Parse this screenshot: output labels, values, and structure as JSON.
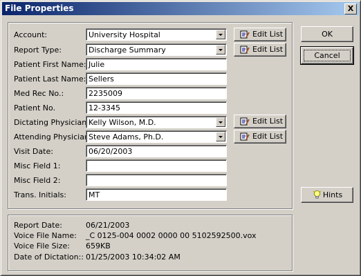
{
  "window": {
    "title": "File Properties",
    "close_glyph": "X"
  },
  "form": {
    "account": {
      "label": "Account:",
      "value": "University Hospital"
    },
    "report_type": {
      "label": "Report Type:",
      "value": "Discharge Summary"
    },
    "patient_first": {
      "label": "Patient First Name:",
      "value": "Julie"
    },
    "patient_last": {
      "label": "Patient Last Name:",
      "value": "Sellers"
    },
    "med_rec": {
      "label": "Med Rec No.:",
      "value": "2235009"
    },
    "patient_no": {
      "label": "Patient No.",
      "value": "12-3345"
    },
    "dictating": {
      "label": "Dictating Physician:",
      "value": "Kelly Wilson, M.D."
    },
    "attending": {
      "label": "Attending Physician:",
      "value": "Steve Adams, Ph.D."
    },
    "visit_date": {
      "label": "Visit Date:",
      "value": "06/20/2003"
    },
    "misc1": {
      "label": "Misc Field 1:",
      "value": ""
    },
    "misc2": {
      "label": "Misc Field 2:",
      "value": ""
    },
    "trans": {
      "label": "Trans. Initials:",
      "value": "MT"
    }
  },
  "edit_list_label": "Edit List",
  "buttons": {
    "ok": "OK",
    "cancel": "Cancel",
    "hints": "Hints"
  },
  "info": {
    "report_date": {
      "label": "Report Date:",
      "value": "06/21/2003"
    },
    "voice_file": {
      "label": "Voice File Name:",
      "value": "_C 0125-004 0002 0000 00 5102592500.vox"
    },
    "voice_size": {
      "label": "Voice File Size:",
      "value": "659KB"
    },
    "dictation_date": {
      "label": "Date of Dictation::",
      "value": "01/25/2003 10:34:02 AM"
    }
  },
  "icons": {
    "edit_list": "notepad-pencil-icon",
    "hints": "lightbulb-icon"
  }
}
